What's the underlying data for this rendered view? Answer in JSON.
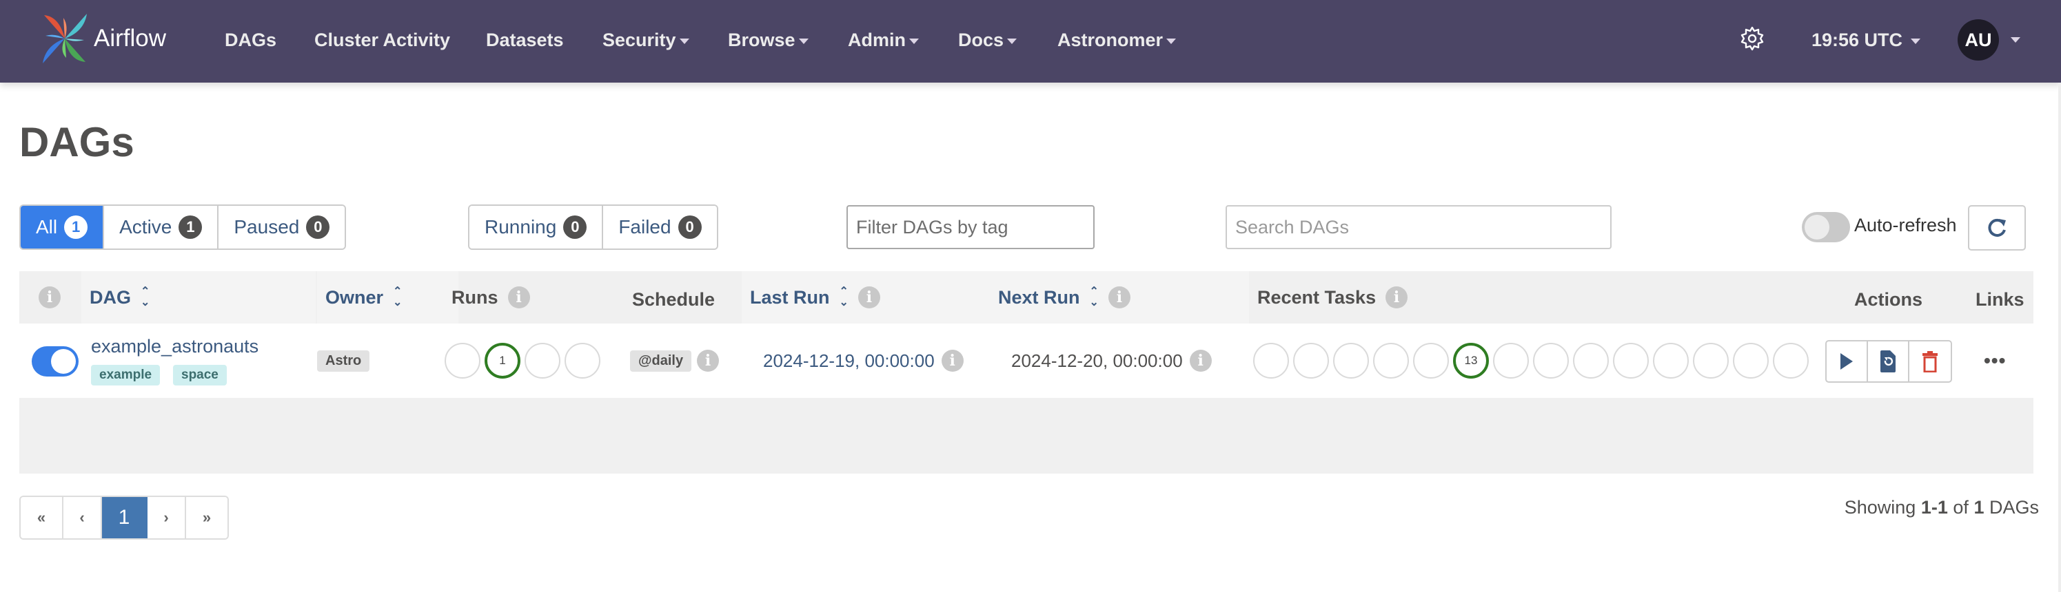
{
  "navbar": {
    "brand": "Airflow",
    "items": [
      {
        "label": "DAGs",
        "dropdown": false
      },
      {
        "label": "Cluster Activity",
        "dropdown": false
      },
      {
        "label": "Datasets",
        "dropdown": false
      },
      {
        "label": "Security",
        "dropdown": true
      },
      {
        "label": "Browse",
        "dropdown": true
      },
      {
        "label": "Admin",
        "dropdown": true
      },
      {
        "label": "Docs",
        "dropdown": true
      },
      {
        "label": "Astronomer",
        "dropdown": true
      }
    ],
    "settings_icon": "gear-icon",
    "time": "19:56 UTC",
    "user_initials": "AU",
    "bg_color": "#4b4565"
  },
  "page": {
    "title": "DAGs"
  },
  "filters": {
    "status_tabs": [
      {
        "label": "All",
        "count": "1",
        "active": true
      },
      {
        "label": "Active",
        "count": "1",
        "active": false
      },
      {
        "label": "Paused",
        "count": "0",
        "active": false
      }
    ],
    "run_tabs": [
      {
        "label": "Running",
        "count": "0"
      },
      {
        "label": "Failed",
        "count": "0"
      }
    ],
    "tag_filter_placeholder": "Filter DAGs by tag",
    "search_placeholder": "Search DAGs",
    "auto_refresh_label": "Auto-refresh",
    "auto_refresh_on": false,
    "accent_color": "#377ee8"
  },
  "table": {
    "headers": {
      "dag": "DAG",
      "owner": "Owner",
      "runs": "Runs",
      "schedule": "Schedule",
      "last_run": "Last Run",
      "next_run": "Next Run",
      "recent_tasks": "Recent Tasks",
      "actions": "Actions",
      "links": "Links"
    },
    "rows": [
      {
        "active": true,
        "dag_id": "example_astronauts",
        "tags": [
          "example",
          "space"
        ],
        "owner": "Astro",
        "runs": [
          "",
          "1",
          "",
          ""
        ],
        "runs_success_index": 1,
        "schedule": "@daily",
        "last_run": "2024-12-19, 00:00:00",
        "next_run": "2024-12-20, 00:00:00",
        "recent_tasks": [
          "",
          "",
          "",
          "",
          "",
          "13",
          "",
          "",
          "",
          "",
          "",
          "",
          "",
          ""
        ],
        "recent_tasks_success_index": 5,
        "success_color": "#2f7d22"
      }
    ]
  },
  "pagination": {
    "first": "«",
    "prev": "‹",
    "current": "1",
    "next": "›",
    "last": "»"
  },
  "summary": {
    "prefix": "Showing",
    "range": "1-1",
    "of": "of",
    "total": "1",
    "suffix": "DAGs"
  }
}
